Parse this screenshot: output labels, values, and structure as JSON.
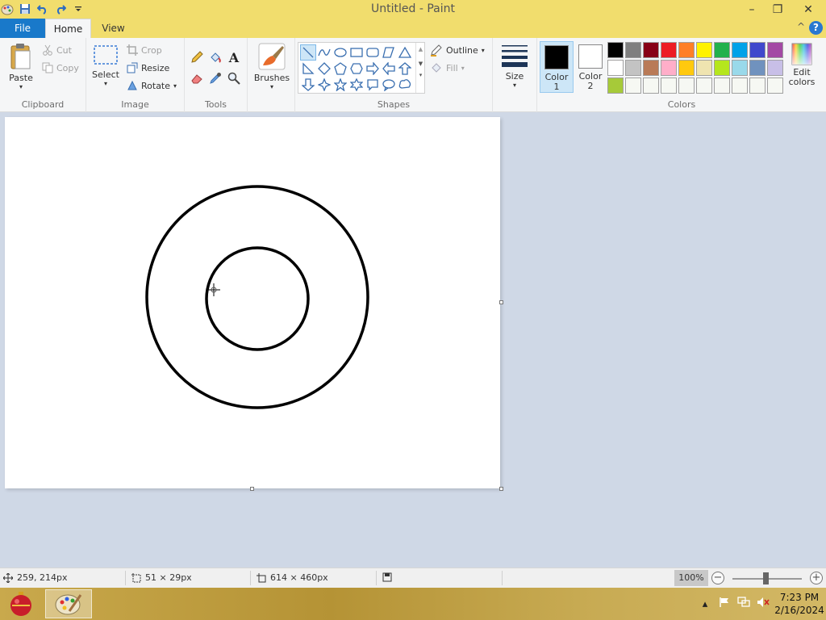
{
  "window": {
    "title": "Untitled - Paint",
    "minimize": "–",
    "restore": "❐",
    "close": "✕"
  },
  "tabs": {
    "file": "File",
    "home": "Home",
    "view": "View",
    "help": "?",
    "collapse": "^"
  },
  "clipboard": {
    "label": "Clipboard",
    "paste": "Paste",
    "cut": "Cut",
    "copy": "Copy"
  },
  "image": {
    "label": "Image",
    "select": "Select",
    "crop": "Crop",
    "resize": "Resize",
    "rotate": "Rotate"
  },
  "tools": {
    "label": "Tools",
    "text_glyph": "A"
  },
  "brushes": {
    "label": "Brushes"
  },
  "shapes": {
    "label": "Shapes",
    "outline": "Outline",
    "fill": "Fill"
  },
  "size": {
    "label": "Size"
  },
  "colors": {
    "label": "Colors",
    "color1_line1": "Color",
    "color1_line2": "1",
    "color2_line1": "Color",
    "color2_line2": "2",
    "edit_line1": "Edit",
    "edit_line2": "colors",
    "color1": "#000000",
    "color2": "#ffffff",
    "palette": [
      "#000000",
      "#7f7f7f",
      "#880015",
      "#ed1c24",
      "#ff7f27",
      "#fff200",
      "#22b14c",
      "#00a2e8",
      "#3f48cc",
      "#a349a4",
      "#ffffff",
      "#c3c3c3",
      "#b97a57",
      "#ffaec9",
      "#ffc90e",
      "#efe4b0",
      "#b5e61d",
      "#99d9ea",
      "#7092be",
      "#c8bfe7",
      "#a6ca39",
      "#f6f8f3",
      "#f6f8f3",
      "#f6f8f3",
      "#f6f8f3",
      "#f6f8f3",
      "#f6f8f3",
      "#f6f8f3",
      "#f6f8f3",
      "#f6f8f3"
    ]
  },
  "status": {
    "cursor_pos": "259, 214px",
    "selection_size": "51 × 29px",
    "canvas_size": "614 × 460px",
    "zoom": "100%",
    "zoom_minus": "−",
    "zoom_plus": "+"
  },
  "taskbar": {
    "time": "7:23 PM",
    "date": "2/16/2024"
  }
}
